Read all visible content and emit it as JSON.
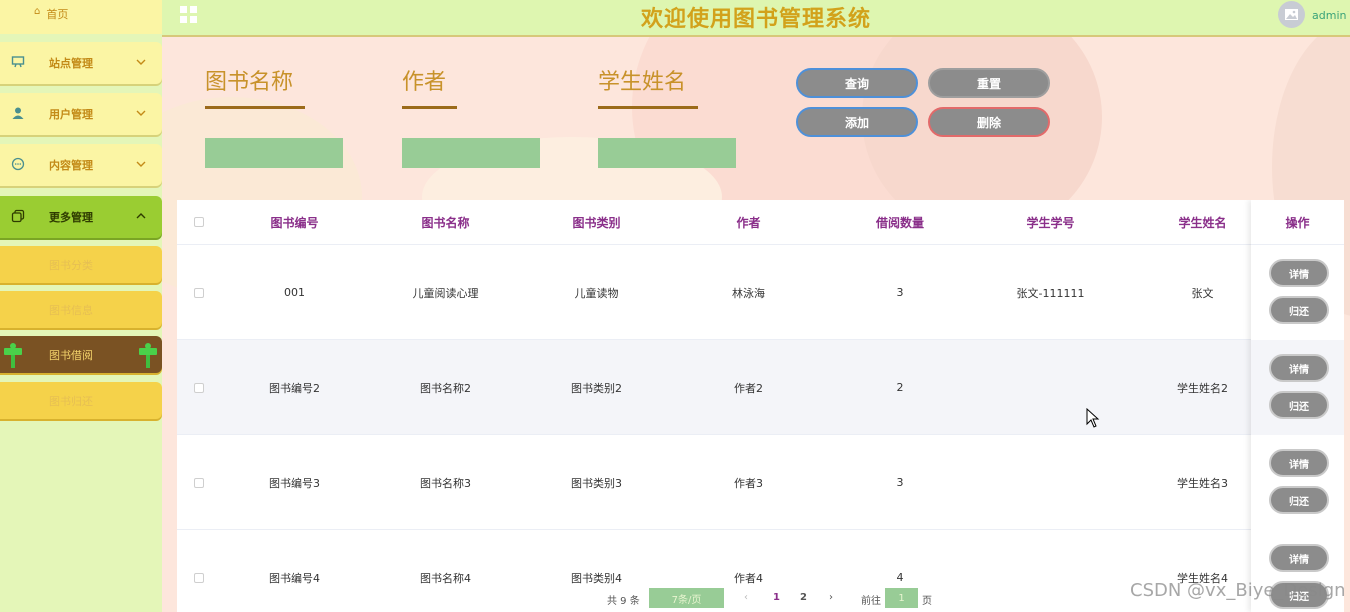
{
  "header": {
    "title": "欢迎使用图书管理系统",
    "username": "admin"
  },
  "sidebar": {
    "home": "首页",
    "menus": [
      {
        "label": "站点管理",
        "icon": "monitor-icon"
      },
      {
        "label": "用户管理",
        "icon": "user-icon"
      },
      {
        "label": "内容管理",
        "icon": "chat-icon"
      },
      {
        "label": "更多管理",
        "icon": "copy-icon"
      }
    ],
    "submenus": [
      "图书分类",
      "图书信息",
      "图书借阅",
      "图书归还"
    ]
  },
  "search": {
    "fields": [
      {
        "label": "图书名称"
      },
      {
        "label": "作者"
      },
      {
        "label": "学生姓名"
      }
    ],
    "buttons": {
      "query": "查询",
      "reset": "重置",
      "add": "添加",
      "delete": "删除"
    }
  },
  "table": {
    "headers": [
      "图书编号",
      "图书名称",
      "图书类别",
      "作者",
      "借阅数量",
      "学生学号",
      "学生姓名",
      "操作"
    ],
    "rows": [
      [
        "001",
        "儿童阅读心理",
        "儿童读物",
        "林泳海",
        "3",
        "张文-111111",
        "张文"
      ],
      [
        "图书编号2",
        "图书名称2",
        "图书类别2",
        "作者2",
        "2",
        "",
        "学生姓名2"
      ],
      [
        "图书编号3",
        "图书名称3",
        "图书类别3",
        "作者3",
        "3",
        "",
        "学生姓名3"
      ],
      [
        "图书编号4",
        "图书名称4",
        "图书类别4",
        "作者4",
        "4",
        "",
        "学生姓名4"
      ]
    ],
    "row_actions": {
      "detail": "详情",
      "return": "归还"
    }
  },
  "pagination": {
    "total": "共 9 条",
    "page_size": "7条/页",
    "prev": "‹",
    "pages": [
      "1",
      "2"
    ],
    "next": "›",
    "goto_label": "前往",
    "goto_value": "1",
    "page_unit": "页"
  },
  "watermark": "CSDN @vx_Biye_Design"
}
